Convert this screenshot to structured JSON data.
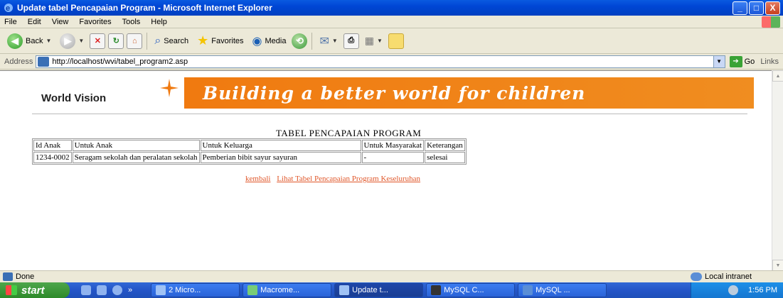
{
  "window": {
    "title": "Update tabel Pencapaian Program - Microsoft Internet Explorer",
    "controls": [
      "_",
      "□",
      "X"
    ]
  },
  "menu": [
    "File",
    "Edit",
    "View",
    "Favorites",
    "Tools",
    "Help"
  ],
  "toolbar": {
    "back_label": "Back",
    "search_label": "Search",
    "favorites_label": "Favorites",
    "media_label": "Media"
  },
  "address": {
    "label": "Address",
    "url": "http://localhost/wvi/tabel_program2.asp",
    "go_label": "Go",
    "links_label": "Links"
  },
  "page": {
    "logo_text": "World Vision",
    "slogan": "Building a better world for children",
    "table_title": "TABEL PENCAPAIAN PROGRAM",
    "columns": [
      "Id Anak",
      "Untuk Anak",
      "Untuk Keluarga",
      "Untuk Masyarakat",
      "Keterangan"
    ],
    "rows": [
      [
        "1234-0002",
        "Seragam sekolah dan peralatan sekolah",
        "Pemberian bibit sayur sayuran",
        "-",
        "selesai"
      ]
    ],
    "link_back": "kembali",
    "link_all": "Lihat Tabel Pencapaian Program Keseluruhan"
  },
  "status": {
    "left": "Done",
    "zone": "Local intranet"
  },
  "taskbar": {
    "start_label": "start",
    "tasks": [
      "2 Micro...",
      "Macrome...",
      "Update t...",
      "MySQL C...",
      "MySQL ..."
    ],
    "clock": "1:56 PM"
  },
  "colors": {
    "titlebar": "#0046d5",
    "banner_orange": "#f07a10",
    "link": "#e0572a",
    "taskbar": "#2455c8"
  }
}
